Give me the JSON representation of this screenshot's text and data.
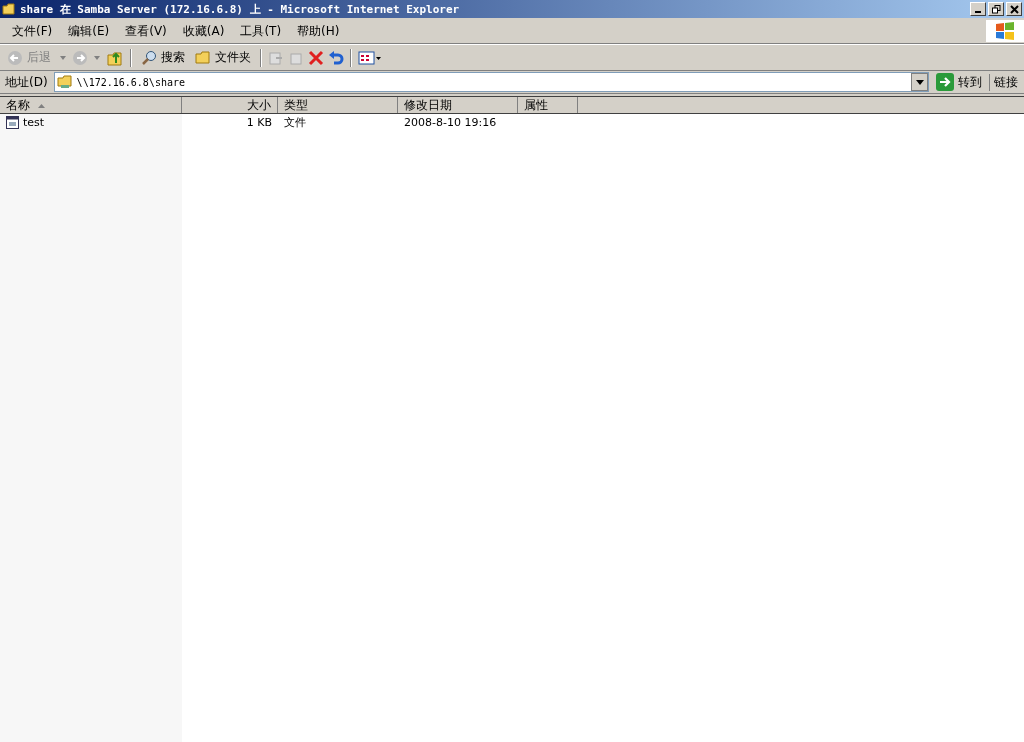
{
  "window": {
    "title": "share 在 Samba Server (172.16.6.8) 上 - Microsoft Internet Explorer"
  },
  "menu": [
    "文件(F)",
    "编辑(E)",
    "查看(V)",
    "收藏(A)",
    "工具(T)",
    "帮助(H)"
  ],
  "toolbar": {
    "back": "后退",
    "search": "搜索",
    "folders": "文件夹"
  },
  "address": {
    "label": "地址(D)",
    "value": "\\\\172.16.6.8\\share",
    "go": "转到",
    "links": "链接"
  },
  "table": {
    "columns": [
      {
        "label": "名称",
        "sorted": true
      },
      {
        "label": "大小",
        "sorted": false
      },
      {
        "label": "类型",
        "sorted": false
      },
      {
        "label": "修改日期",
        "sorted": false
      },
      {
        "label": "属性",
        "sorted": false
      }
    ],
    "rows": [
      {
        "name": "test",
        "size": "1 KB",
        "type": "文件",
        "modified": "2008-8-10 19:16",
        "attributes": ""
      }
    ]
  }
}
